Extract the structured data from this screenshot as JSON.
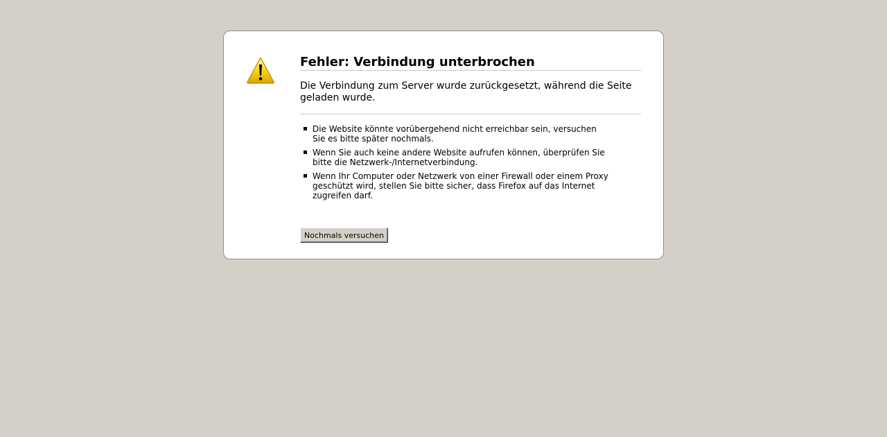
{
  "error": {
    "title": "Fehler: Verbindung unterbrochen",
    "description": "Die Verbindung zum Server wurde zurückgesetzt, während die Seite geladen wurde.",
    "hints": [
      "Die Website könnte vorübergehend nicht erreichbar sein, versuchen Sie es bitte später nochmals.",
      "Wenn Sie auch keine andere Website aufrufen können, überprüfen Sie bitte die Netzwerk-/Internetverbindung.",
      "Wenn Ihr Computer oder Netzwerk von einer Firewall oder einem Proxy geschützt wird, stellen Sie bitte sicher, dass Firefox auf das Internet zugreifen darf."
    ],
    "retry_label": "Nochmals versuchen",
    "icon": "warning-icon"
  },
  "colors": {
    "page_background": "#d4d0c8",
    "box_background": "#ffffff",
    "warning_yellow": "#f7d11a"
  }
}
